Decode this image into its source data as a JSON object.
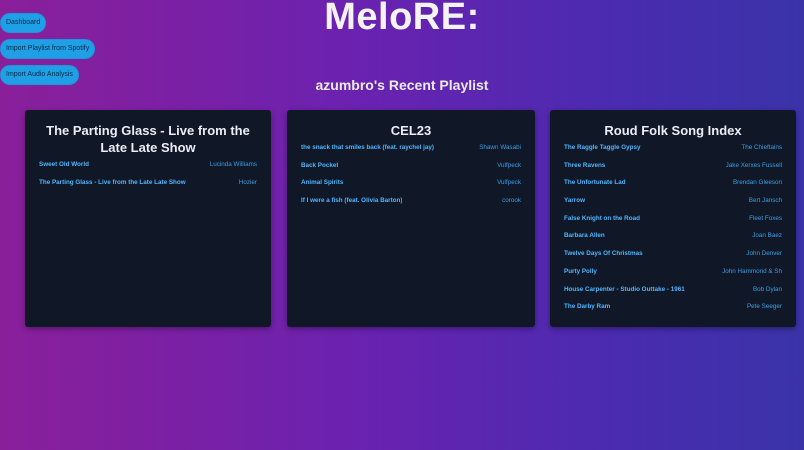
{
  "nav": {
    "dashboard": "Dashboard",
    "import_playlist": "Import Playlist from Spotify",
    "import_audio": "Import Audio Analysis"
  },
  "app_title": "MeloRE:",
  "subtitle": "azumbro's Recent Playlist",
  "colors": {
    "accent": "#1fa0e6",
    "card_bg": "#101827",
    "link": "#4fb6ff",
    "bg_left": "#8a1f9a",
    "bg_right": "#3a33a8"
  },
  "playlists": [
    {
      "title": "The Parting Glass - Live from the Late Late Show",
      "tracks": [
        {
          "name": "Sweet Old World",
          "artist": "Lucinda Williams"
        },
        {
          "name": "The Parting Glass - Live from the Late Late Show",
          "artist": "Hozier"
        }
      ]
    },
    {
      "title": "CEL23",
      "tracks": [
        {
          "name": "the snack that smiles back (feat. raychel jay)",
          "artist": "Shawn Wasabi"
        },
        {
          "name": "Back Pocket",
          "artist": "Vulfpeck"
        },
        {
          "name": "Animal Spirits",
          "artist": "Vulfpeck"
        },
        {
          "name": "If I were a fish (feat. Olivia Barton)",
          "artist": "corook"
        }
      ]
    },
    {
      "title": "Roud Folk Song Index",
      "tracks": [
        {
          "name": "The Raggle Taggle Gypsy",
          "artist": "The Chieftains"
        },
        {
          "name": "Three Ravens",
          "artist": "Jake Xerxes Fussell"
        },
        {
          "name": "The Unfortunate Lad",
          "artist": "Brendan Gleeson"
        },
        {
          "name": "Yarrow",
          "artist": "Bert Jansch"
        },
        {
          "name": "False Knight on the Road",
          "artist": "Fleet Foxes"
        },
        {
          "name": "Barbara Allen",
          "artist": "Joan Baez"
        },
        {
          "name": "Twelve Days Of Christmas",
          "artist": "John Denver"
        },
        {
          "name": "Purty Polly",
          "artist": "John Hammond & Sh"
        },
        {
          "name": "House Carpenter - Studio Outtake - 1961",
          "artist": "Bob Dylan"
        },
        {
          "name": "The Darby Ram",
          "artist": "Pete Seeger"
        }
      ]
    }
  ]
}
